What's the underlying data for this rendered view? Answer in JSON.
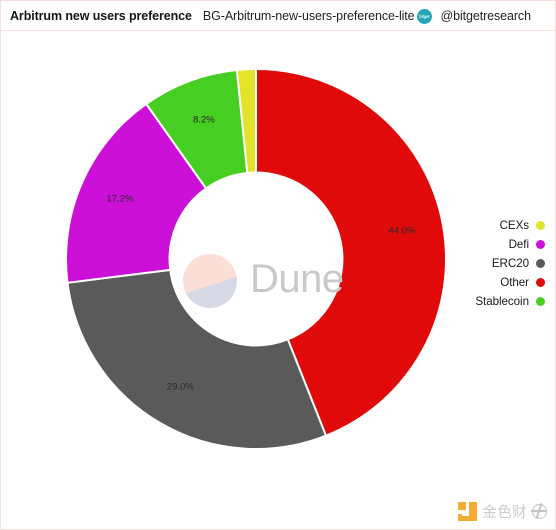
{
  "header": {
    "title": "Arbitrum new users preference",
    "subtitle": "BG-Arbitrum-new-users-preference-lite",
    "badge_text": "bitget",
    "handle": "@bitgetresearch"
  },
  "watermarks": {
    "dune": "Dune",
    "jinse": "金色财"
  },
  "legend": {
    "items": [
      {
        "label": "CEXs",
        "color": "#e3e329"
      },
      {
        "label": "Defi",
        "color": "#cc10d8"
      },
      {
        "label": "ERC20",
        "color": "#5a5a5a"
      },
      {
        "label": "Other",
        "color": "#e00a0a"
      },
      {
        "label": "Stablecoin",
        "color": "#47ce22"
      }
    ]
  },
  "chart_data": {
    "type": "pie",
    "variant": "donut",
    "title": "Arbitrum new users preference",
    "start_angle_deg": 0,
    "direction": "clockwise",
    "inner_radius_ratio": 0.455,
    "labels": [
      "Other",
      "ERC20",
      "Defi",
      "Stablecoin",
      "CEXs"
    ],
    "values": [
      44.0,
      29.0,
      17.2,
      8.2,
      1.6
    ],
    "colors": [
      "#e00a0a",
      "#5a5a5a",
      "#cc10d8",
      "#47ce22",
      "#e3e329"
    ],
    "value_labels": [
      "44.0%",
      "29.0%",
      "17.2%",
      "8.2%",
      "1.6%"
    ],
    "shown_value_labels": [
      "44.0%",
      "29.0%",
      "17.2%",
      "8.2%"
    ],
    "legend_position": "right",
    "grid": false,
    "units": "percent"
  }
}
